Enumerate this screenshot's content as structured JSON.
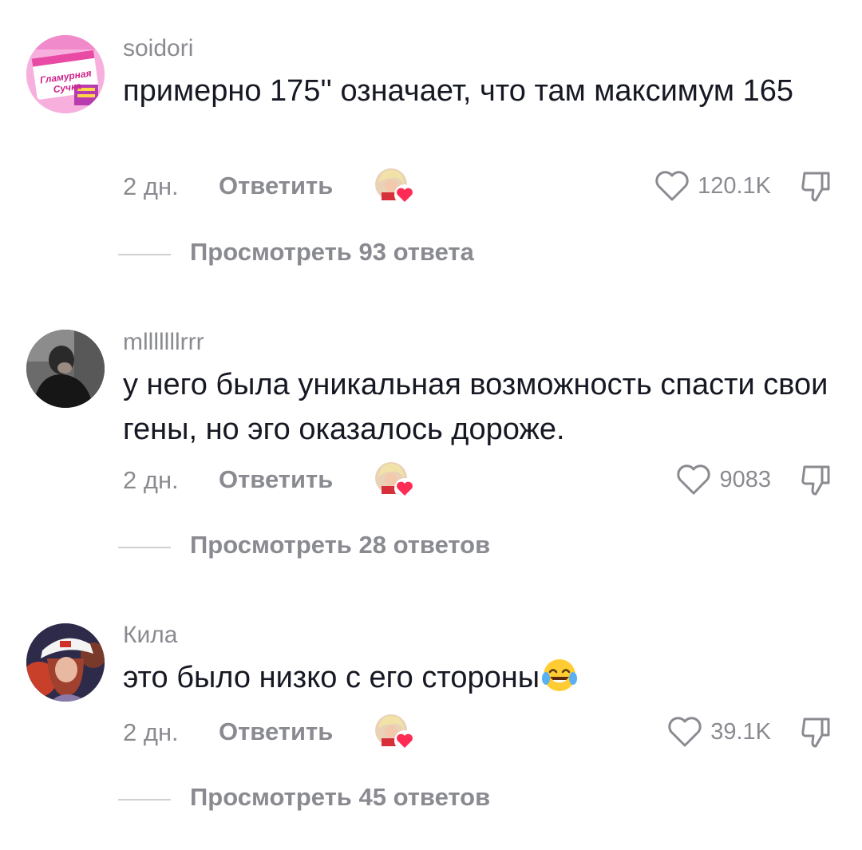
{
  "comments": [
    {
      "username": "soidori",
      "text": "примерно 175'' означает, что там максимум 165",
      "time": "2 дн.",
      "reply_label": "Ответить",
      "likes": "120.1K",
      "view_replies": "Просмотреть 93 ответа",
      "avatar_text_line1": "Гламурная",
      "avatar_text_line2": "Сучка"
    },
    {
      "username": "mlllllllrrr",
      "text": "у него была уникальная возможность спасти свои гены, но эго оказалось дороже.",
      "time": "2 дн.",
      "reply_label": "Ответить",
      "likes": "9083",
      "view_replies": "Просмотреть 28 ответов"
    },
    {
      "username": "Кила",
      "text": "это было низко с его стороны",
      "emoji": "face-with-tears-of-joy-icon",
      "time": "2 дн.",
      "reply_label": "Ответить",
      "likes": "39.1K",
      "view_replies": "Просмотреть 45 ответов"
    }
  ],
  "colors": {
    "primary_text": "#161823",
    "secondary_text": "#8a8b91",
    "heart_badge": "#fe2c55",
    "divider": "#d0d0d3"
  }
}
